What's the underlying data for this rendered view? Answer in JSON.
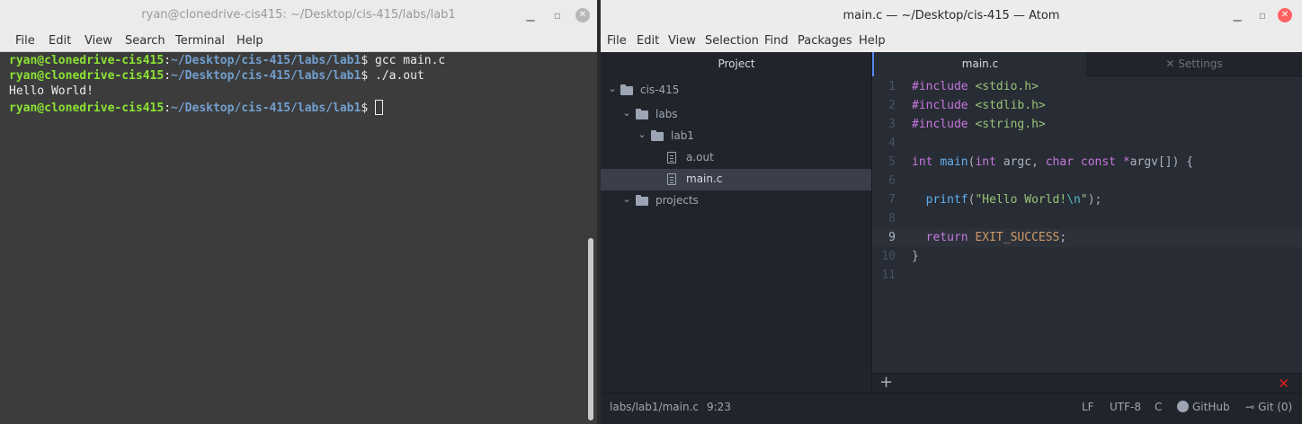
{
  "terminal": {
    "title": "ryan@clonedrive-cis415: ~/Desktop/cis-415/labs/lab1",
    "menu": [
      "File",
      "Edit",
      "View",
      "Search",
      "Terminal",
      "Help"
    ],
    "lines": [
      {
        "user": "ryan@clonedrive-cis415",
        "sep": ":",
        "path": "~/Desktop/cis-415/labs/lab1",
        "cmd": "$ gcc main.c"
      },
      {
        "user": "ryan@clonedrive-cis415",
        "sep": ":",
        "path": "~/Desktop/cis-415/labs/lab1",
        "cmd": "$ ./a.out"
      },
      {
        "output": "Hello World!"
      },
      {
        "user": "ryan@clonedrive-cis415",
        "sep": ":",
        "path": "~/Desktop/cis-415/labs/lab1",
        "cmd": "$ "
      }
    ]
  },
  "atom": {
    "title": "main.c — ~/Desktop/cis-415 — Atom",
    "menu": [
      "File",
      "Edit",
      "View",
      "Selection",
      "Find",
      "Packages",
      "Help"
    ],
    "tree": {
      "header": "Project",
      "items": [
        {
          "label": "cis-415",
          "kind": "folder",
          "expanded": true
        },
        {
          "label": "labs",
          "kind": "folder",
          "expanded": true
        },
        {
          "label": "lab1",
          "kind": "folder",
          "expanded": true
        },
        {
          "label": "a.out",
          "kind": "file"
        },
        {
          "label": "main.c",
          "kind": "file",
          "selected": true
        },
        {
          "label": "projects",
          "kind": "folder",
          "expanded": true
        }
      ]
    },
    "tabs": [
      {
        "label": "main.c",
        "active": true
      },
      {
        "label": "Settings",
        "icon": "wrench-icon",
        "active": false
      }
    ],
    "code": {
      "line_numbers": [
        "1",
        "2",
        "3",
        "4",
        "5",
        "6",
        "7",
        "8",
        "9",
        "10",
        "11"
      ],
      "highlighted_line": "9",
      "lines": [
        "#include <stdio.h>",
        "#include <stdlib.h>",
        "#include <string.h>",
        "",
        "int main(int argc, char const *argv[]) {",
        "",
        "  printf(\"Hello World!\\n\");",
        "",
        "  return EXIT_SUCCESS;",
        "}",
        ""
      ]
    },
    "panel": {
      "add": "+",
      "close": "✕"
    },
    "status": {
      "path": "labs/lab1/main.c",
      "cursor": "9:23",
      "line_ending": "LF",
      "encoding": "UTF-8",
      "grammar": "C",
      "github": "GitHub",
      "git": "Git (0)"
    },
    "colors": {
      "accent": "#568af2",
      "close_red": "#e02020"
    }
  }
}
